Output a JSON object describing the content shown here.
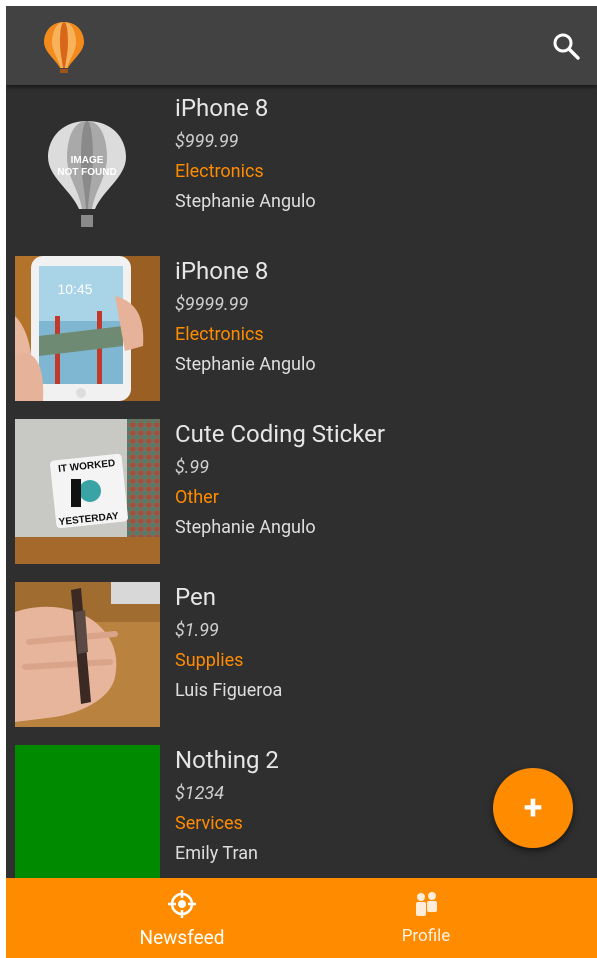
{
  "app": {
    "logo_icon": "hot-air-balloon-icon",
    "search_icon": "search-icon",
    "accent": "#ff8c00",
    "background": "#2f2f2f",
    "appbar_color": "#424242"
  },
  "listings": [
    {
      "title": "iPhone 8",
      "price": "$999.99",
      "category": "Electronics",
      "seller": "Stephanie Angulo",
      "image": "image-not-found"
    },
    {
      "title": "iPhone 8",
      "price": "$9999.99",
      "category": "Electronics",
      "seller": "Stephanie Angulo",
      "image": "phone-photo"
    },
    {
      "title": "Cute Coding Sticker",
      "price": "$.99",
      "category": "Other",
      "seller": "Stephanie Angulo",
      "image": "sticker-photo"
    },
    {
      "title": "Pen",
      "price": "$1.99",
      "category": "Supplies",
      "seller": "Luis Figueroa",
      "image": "pen-photo"
    },
    {
      "title": "Nothing 2",
      "price": "$1234",
      "category": "Services",
      "seller": "Emily Tran",
      "image": "green-image"
    }
  ],
  "placeholder_image": {
    "line1": "IMAGE",
    "line2": "NOT FOUND"
  },
  "sticker_text": {
    "top": "IT WORKED",
    "bottom": "YESTERDAY"
  },
  "phone_time": "10:45",
  "fab": {
    "label": "+"
  },
  "bottom_nav": {
    "items": [
      {
        "label": "Newsfeed",
        "icon": "crosshair-icon",
        "active": true
      },
      {
        "label": "Profile",
        "icon": "people-icon",
        "active": false
      }
    ]
  }
}
